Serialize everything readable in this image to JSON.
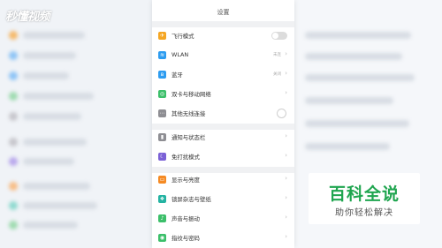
{
  "watermark": {
    "left_text": "秒懂视频",
    "badge_title": "百科全说",
    "badge_subtitle": "助你轻松解决"
  },
  "colors": {
    "accent_green": "#1fa54f",
    "panel": "#ffffff",
    "section_gap": "#f0f1f3"
  },
  "settings": {
    "title": "设置",
    "items": [
      {
        "label": "飞行模式",
        "icon": "airplane-icon",
        "color": "#f5a623",
        "control": "toggle",
        "value": "",
        "toggled": false
      },
      {
        "label": "WLAN",
        "icon": "wifi-icon",
        "color": "#2d9cf0",
        "control": "chevron",
        "value": "未连"
      },
      {
        "label": "蓝牙",
        "icon": "bluetooth-icon",
        "color": "#2d9cf0",
        "control": "chevron",
        "value": "关闭"
      },
      {
        "label": "双卡与移动网络",
        "icon": "network-icon",
        "color": "#3cbf6a",
        "control": "chevron",
        "value": ""
      },
      {
        "label": "其他无线连接",
        "icon": "wireless-icon",
        "color": "#8e8e93",
        "control": "circle",
        "value": ""
      },
      {
        "label": "通知与状态栏",
        "icon": "notification-icon",
        "color": "#8e8e93",
        "control": "chevron",
        "value": ""
      },
      {
        "label": "免打扰模式",
        "icon": "moon-icon",
        "color": "#7b61d6",
        "control": "chevron",
        "value": ""
      },
      {
        "label": "显示与亮度",
        "icon": "display-icon",
        "color": "#f58a23",
        "control": "chevron",
        "value": ""
      },
      {
        "label": "锁屏杂志与壁纸",
        "icon": "wallpaper-icon",
        "color": "#24b3a2",
        "control": "chevron",
        "value": ""
      },
      {
        "label": "声音与振动",
        "icon": "sound-icon",
        "color": "#3cbf6a",
        "control": "chevron",
        "value": ""
      },
      {
        "label": "指纹与密码",
        "icon": "fingerprint-icon",
        "color": "#3cbf6a",
        "control": "chevron",
        "value": ""
      }
    ]
  }
}
